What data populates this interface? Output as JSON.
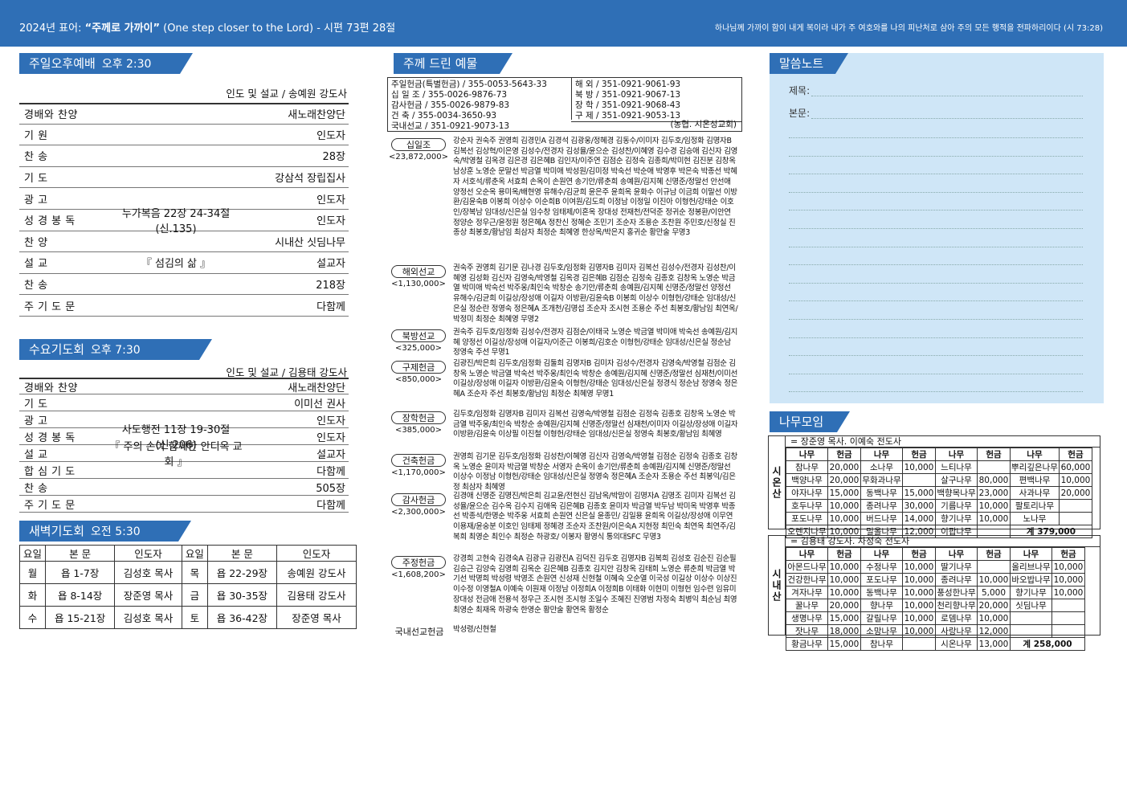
{
  "header": {
    "year_label": "2024년 표어: ",
    "motto": "“주께로 가까이”",
    "motto_en": " (One step closer to the Lord) - 시편 73편 28절",
    "verse": "하나님께 가까이 함이 내게 복이라 내가 주 여호와를 나의 피난처로 삼아 주의 모든 행적을 전파하리이다 (시 73:28)"
  },
  "sunday": {
    "title": "주일오후예배",
    "time": "오후 2:30",
    "leader": "인도 및 설교 / 송예원 강도사",
    "rows": [
      {
        "label": "경배와 찬양",
        "mid": "",
        "right": "새노래찬양단"
      },
      {
        "label": "기      원",
        "mid": "",
        "right": "인도자"
      },
      {
        "label": "찬      송",
        "mid": "",
        "right": "28장"
      },
      {
        "label": "기      도",
        "mid": "",
        "right": "강삼석 장립집사"
      },
      {
        "label": "광      고",
        "mid": "",
        "right": "인도자"
      },
      {
        "label": "성 경 봉 독",
        "mid": "누가복음 22장  24-34절(신.135)",
        "right": "인도자"
      },
      {
        "label": "찬      양",
        "mid": "",
        "right": "시내산 싯딤나무"
      },
      {
        "label": "설      교",
        "mid": "『 섬김의 삶 』",
        "right": "설교자"
      },
      {
        "label": "찬      송",
        "mid": "",
        "right": "218장"
      },
      {
        "label": "주 기 도 문",
        "mid": "",
        "right": "다함께"
      }
    ]
  },
  "wednesday": {
    "title": "수요기도회",
    "time": "오후 7:30",
    "leader": "인도 및 설교 / 김용태 강도사",
    "rows": [
      {
        "label": "경배와 찬양",
        "mid": "",
        "right": "새노래찬양단"
      },
      {
        "label": "기      도",
        "mid": "",
        "right": "이미선 권사"
      },
      {
        "label": "광      고",
        "mid": "",
        "right": "인도자"
      },
      {
        "label": "성 경 봉 독",
        "mid": "사도행전  11장  19-30절(신.206)",
        "right": "인도자"
      },
      {
        "label": "설      교",
        "mid": "『 주의 손이 함께한 안디옥 교회 』",
        "right": "설교자"
      },
      {
        "label": "합 심 기 도",
        "mid": "",
        "right": "다함께"
      },
      {
        "label": "찬      송",
        "mid": "",
        "right": "505장"
      },
      {
        "label": "주 기 도 문",
        "mid": "",
        "right": "다함께"
      }
    ]
  },
  "dawn": {
    "title": "새벽기도회",
    "time": "오전 5:30",
    "headers": [
      "요일",
      "본  문",
      "인도자",
      "요일",
      "본  문",
      "인도자"
    ],
    "rows": [
      [
        "월",
        "욥  1-7장",
        "김성호 목사",
        "목",
        "욥  22-29장",
        "송예원 강도사"
      ],
      [
        "화",
        "욥  8-14장",
        "장준영 목사",
        "금",
        "욥  30-35장",
        "김용태 강도사"
      ],
      [
        "수",
        "욥  15-21장",
        "김성호 목사",
        "토",
        "욥  36-42장",
        "장준영 목사"
      ]
    ]
  },
  "offerings": {
    "title": "주께 드린 예물",
    "accounts_left": [
      "주일헌금(특별헌금) / 355-0053-5643-33",
      "십 일 조 / 355-0026-9876-73",
      "감사헌금 / 355-0026-9879-83",
      "건    축 / 355-0034-3650-93",
      "국내선교 / 351-0921-9073-13"
    ],
    "accounts_right": [
      "해    외 / 351-0921-9061-93",
      "북    방 / 351-0921-9067-13",
      "장    학 / 351-0921-9068-43",
      "구    제 / 351-0921-9053-13"
    ],
    "bank": "(농협.  시온성교회)",
    "items": [
      {
        "label": "십일조",
        "amount": "<23,872,000>",
        "names": "강순자 권숙주 권영희 김경민A 김경석 김광웅/정혜경 김동수/이미자 김두호/임정화 김명자B 김복선 김상혁/이은영 김성수/전경자 김성율/윤으순 김성찬/이혜영 김수경 김승애 김신자 김영숙/박영철 김옥경 김은경 김은혜B 김인자/이주연 김점순 김정숙 김종희/박미현 김진분 김창옥 남상훈 노영순 문말선 박금열 박미애 박성원/김미정 박숙선 박순애 박영후 박은숙 박종선 박혜자 서호석/류춘옥 서효희 손옥이 손원연 송기안/류춘희 송예원/김지혜 신명준/정말선 안선애 양정선 오순옥 용미옥/배현영 유해수/김균희 윤은주 윤희옥 윤화수 이규남 이금희 이말선 이방환/김윤숙B 이봉희 이상수 이순희B 이여원/김도희 이정남 이정일 이진아 이형헌/강태순 이호인/장복남 임대성/신은실 임수창 임태제/이혼옥 장대성 전재천/전덕준 정귀순 정봉환/이안연 정양순 정우근/윤정원 정은혜A 정찬신 정혜순 조민기 조순자 조용순 조찬원 주민호/신정실 진종상 최봉호/황남임 최삼자 최정순 최혜영 한상옥/박은지 홍귀순 황만술 무명3"
      },
      {
        "label": "해외선교",
        "amount": "<1,130,000>",
        "names": "권숙주 권영희 김기문 김나경 김두호/임정화 김명자B 김미자 김복선 김성수/전경자 김성찬/이혜영 김성화 김신자 김영숙/박영철 김옥경 김은혜B 김점순 김정숙 김종호 김창옥 노영순 박금열 박미애 박숙선 박주웅/최인숙 박창순 송기안/류춘희 송예원/김지혜 신명준/정말선 양정선 유해수/김균희 이길상/장성애 이길자 이방환/김윤숙B 이봉희 이상수 이형헌/강태순 임대성/신은실 정순란 정영숙 정은혜A 조개천/김명섭 조순자 조시현 조용순 주선 최봉호/황남임 최연옥/박정미 최정순 최혜영 무명2"
      },
      {
        "label": "북방선교",
        "amount": "<325,000>",
        "names": "권숙주 김두호/임정화 김성수/전경자 김점순/이태국 노영순 박금열 박미애 박숙선 송예원/김지혜 양정선 이길상/장성애 이길자/이준근 이봉희/김호순 이형헌/강태순 임대성/신은실 정순남 정영숙 주선 무명1"
      },
      {
        "label": "구제헌금",
        "amount": "<850,000>",
        "names": "김광진/박은희 김두호/임정화 김둘희 김명자B 김미자 김성수/전경자 김영숙/박영철 김점순 김창옥 노영순 박금열 박숙선 박주웅/최인숙 박창순 송예원/김지혜 신명준/정말선 심재천/이미선 이길상/장성애 이길자 이방환/김윤숙 이형헌/강태순 임대성/신은실 정경식 정순남 정영숙 정은혜A 조순자 주선 최봉호/황남임 최정순 최혜영 무명1"
      },
      {
        "label": "장학헌금",
        "amount": "<385,000>",
        "names": "김두호/임정화 김명자B 김미자 김복선 김영숙/박영철 김점순 김정숙 김종호 김창옥 노영순 박금열 박주웅/최인숙 박창순 송예원/김지혜 신명준/정말선 심재천/이미자 이길상/장성애 이길자 이방환/김윤숙 이상필 이진철 이형헌/강태순 임대성/신은실 정영숙 최봉호/황남임 최혜영"
      },
      {
        "label": "건축헌금",
        "amount": "<1,170,000>",
        "names": "권영희 김기문 김두호/임정화 김성찬/이혜영 김신자 김영숙/박영철 김점순 김정숙 김종호 김창옥 노영순 윤미자 박금열 박창순 서영자 손옥이 송기안/류춘희 송예원/김지혜 신명준/정말선 이상수 이정남 이형헌/강태순 임대성/신은실 정영숙 정은혜A 조순자 조용순 주선 최봉익/김은정 최삼자 최혜영"
      },
      {
        "label": "감사헌금",
        "amount": "<2,300,000>",
        "names": "김경애 신명준 김명진/박은희 김교윤/전현신 김남옥/박맘이 김명자A 김명조 김미자 김복선 김성율/윤으순 김수옥 김수지 김애옥 김은혜B 김종호 윤미자 박금열 박두남 박미옥 박영후 박종선 박종석/한명순 박주웅 서효희 손원연 신은실 윤종민/ 김일용 윤희옥 이길상/장성애 이무연 이용재/윤숭분 이호인 임태제 정혜경 조순자 조찬원/이은숙A 지현정 최민숙 최연옥 최연주/김복희 최영순 최인수 최정순 하광호/ 이봉자 황영식 통의대SFC 무명3"
      },
      {
        "label": "주정헌금",
        "amount": "<1,608,200>",
        "names": "강경희 고현숙 김경숙A 김광규 김광진A 김덕진 김두호 김명자B 김복희 김성호 김순진 김순필 김승근 김양숙 김영희 김옥순 김은혜B 김종호 김지안 김창옥 김태희 노영순 류춘희 박금열 박기선 박명희 박성령 박영조 손원연 신성재 신현철 이혜숙 오순열 이국성 이길상 이상수 이상진 이수정 이영철A 이예숙 이원재 이정남 이정희A 이정희B 이태화 이현미 이형헌 임수련 임유미 장대성 전금애 전용석 정우근 조시현 조시형 조일수 조혜진 진영범 차정숙 최병익 최순님 최영 최영순 최재옥 하광숙 한영순 황만술 황연옥 황정순"
      },
      {
        "label": "국내선교헌금",
        "amount": "",
        "names": "박성령/신현철"
      }
    ]
  },
  "sermon_note": {
    "title": "말씀노트",
    "subject_label": "제목:",
    "body_label": "본문:"
  },
  "tree_meeting": {
    "title": "나무모임",
    "col_headers": [
      "나무",
      "헌금",
      "나무",
      "헌금",
      "나무",
      "헌금",
      "나무",
      "헌금"
    ],
    "zion": {
      "side": "시온산",
      "head": "= 장준영 목사. 이예숙 전도사",
      "rows": [
        [
          "참나무",
          "20,000",
          "소나무",
          "10,000",
          "느티나무",
          "",
          "뿌리깊은나무",
          "60,000"
        ],
        [
          "백양나무",
          "20,000",
          "무화과나무",
          "",
          "살구나무",
          "80,000",
          "편백나무",
          "10,000"
        ],
        [
          "야자나무",
          "15,000",
          "동백나무",
          "15,000",
          "백향목나무",
          "23,000",
          "사과나무",
          "20,000"
        ],
        [
          "호두나무",
          "10,000",
          "종려나무",
          "30,000",
          "기름나무",
          "10,000",
          "팔토리나무",
          ""
        ],
        [
          "포도나무",
          "10,000",
          "버드나무",
          "14,000",
          "향기나무",
          "10,000",
          "노나무",
          ""
        ],
        [
          "오렌지나무",
          "10,000",
          "밀올나무",
          "12,000",
          "이팝나무",
          "",
          "계 379,000",
          ""
        ]
      ]
    },
    "sinai": {
      "side": "시내산",
      "head": "= 김용태 강도사. 차정숙 전도사",
      "rows": [
        [
          "아몬드나무",
          "10,000",
          "수정나무",
          "10,000",
          "딸기나무",
          "",
          "올리브나무",
          "10,000"
        ],
        [
          "건강한나무",
          "10,000",
          "포도나무",
          "10,000",
          "종려나무",
          "10,000",
          "바오밥나무",
          "10,000"
        ],
        [
          "겨자나무",
          "10,000",
          "동백나무",
          "10,000",
          "풍성한나무",
          "5,000",
          "향기나무",
          "10,000"
        ],
        [
          "꿀나무",
          "20,000",
          "향나무",
          "10,000",
          "천리향나무",
          "20,000",
          "싯딤나무",
          ""
        ],
        [
          "생명나무",
          "15,000",
          "갈릴나무",
          "10,000",
          "로뎀나무",
          "10,000",
          "",
          ""
        ],
        [
          "잣나무",
          "18,000",
          "소망나무",
          "10,000",
          "사랑나무",
          "12,000",
          "",
          ""
        ],
        [
          "황금나무",
          "15,000",
          "참나무",
          "",
          "시온나무",
          "13,000",
          "계 258,000",
          ""
        ]
      ]
    }
  }
}
